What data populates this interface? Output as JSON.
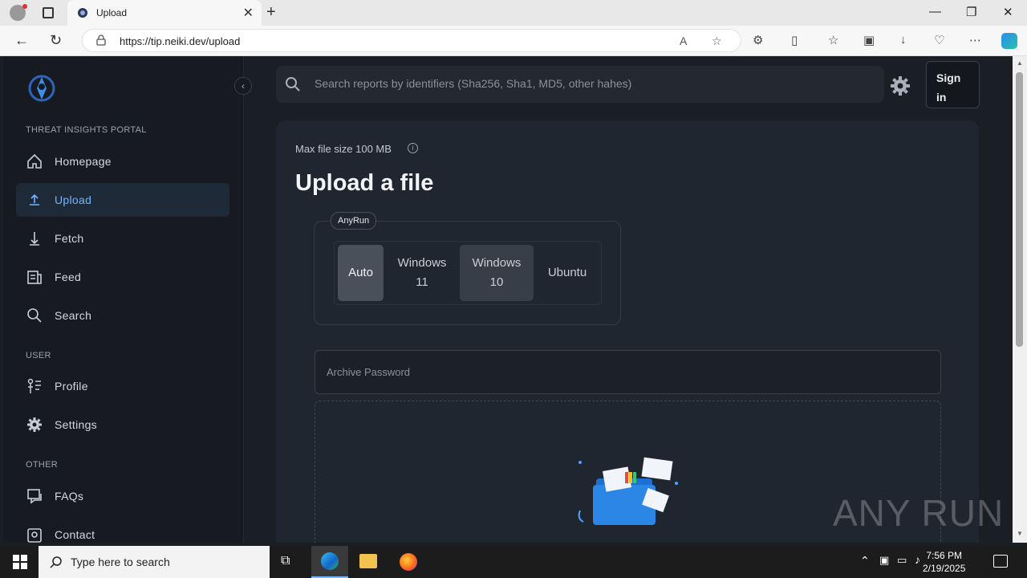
{
  "browser": {
    "tab_title": "Upload",
    "url": "https://tip.neiki.dev/upload"
  },
  "sidebar": {
    "section_portal": "THREAT INSIGHTS PORTAL",
    "section_user": "USER",
    "section_other": "OTHER",
    "items": [
      {
        "label": "Homepage",
        "icon": "home-icon"
      },
      {
        "label": "Upload",
        "icon": "upload-icon",
        "active": true
      },
      {
        "label": "Fetch",
        "icon": "download-icon"
      },
      {
        "label": "Feed",
        "icon": "feed-icon"
      },
      {
        "label": "Search",
        "icon": "search-icon"
      },
      {
        "label": "Profile",
        "icon": "profile-icon"
      },
      {
        "label": "Settings",
        "icon": "gear-icon"
      },
      {
        "label": "FAQs",
        "icon": "faq-icon"
      },
      {
        "label": "Contact",
        "icon": "contact-icon"
      }
    ]
  },
  "header": {
    "search_placeholder": "Search reports by identifiers (Sha256, Sha1, MD5, other hahes)",
    "sign_in": "Sign in"
  },
  "upload": {
    "max_size": "Max file size 100 MB",
    "title": "Upload a file",
    "sandbox_label": "AnyRun",
    "os_options": [
      {
        "label": "Auto",
        "selected": true
      },
      {
        "label": "Windows 11"
      },
      {
        "label": "Windows 10"
      },
      {
        "label": "Ubuntu"
      }
    ],
    "password_placeholder": "Archive Password"
  },
  "watermark": "ANY RUN",
  "taskbar": {
    "search_placeholder": "Type here to search",
    "time": "7:56 PM",
    "date": "2/19/2025"
  },
  "colors": {
    "accent": "#6fb6ff",
    "background": "#1a1e25",
    "sidebar": "#171b21"
  }
}
